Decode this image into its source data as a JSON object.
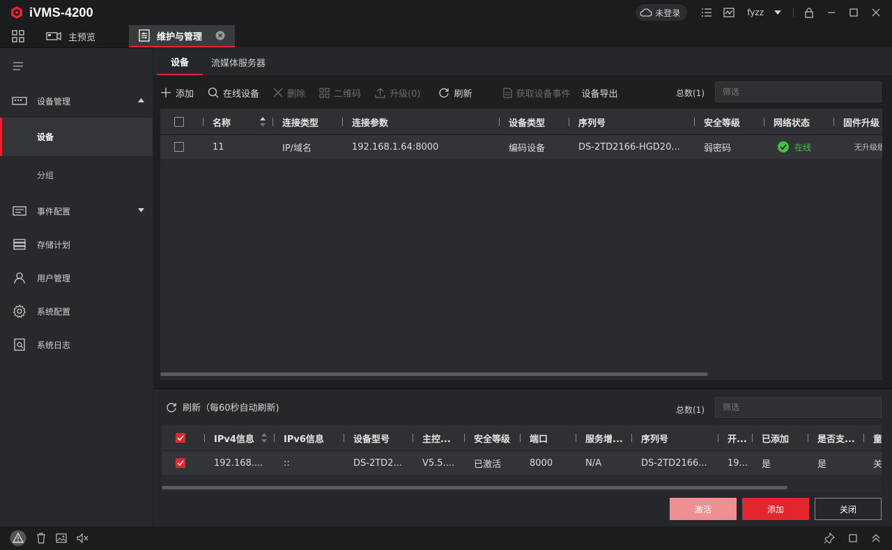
{
  "app": {
    "title": "iVMS-4200",
    "cloud_status": "未登录",
    "user": "fyzz"
  },
  "tabs": [
    {
      "label": "主预览"
    },
    {
      "label": "维护与管理"
    }
  ],
  "sidebar": {
    "items": [
      {
        "label": "设备管理",
        "icon": "device-manage-icon",
        "expanded": true
      },
      {
        "label": "设备",
        "sub": true,
        "active": true
      },
      {
        "label": "分组",
        "sub": true
      },
      {
        "label": "事件配置",
        "icon": "event-config-icon"
      },
      {
        "label": "存储计划",
        "icon": "storage-plan-icon"
      },
      {
        "label": "用户管理",
        "icon": "user-icon"
      },
      {
        "label": "系统配置",
        "icon": "gear-icon"
      },
      {
        "label": "系统日志",
        "icon": "log-icon"
      }
    ]
  },
  "subtabs": [
    "设备",
    "流媒体服务器"
  ],
  "toolbar": {
    "add": "添加",
    "online": "在线设备",
    "delete": "删除",
    "qrcode": "二维码",
    "upgrade": "升级(0)",
    "refresh": "刷新",
    "get_events": "获取设备事件",
    "export": "设备导出",
    "total": "总数(1)",
    "filter_placeholder": "筛选"
  },
  "device_table": {
    "headers": [
      "名称",
      "连接类型",
      "连接参数",
      "设备类型",
      "序列号",
      "安全等级",
      "网络状态",
      "固件升级"
    ],
    "rows": [
      {
        "name": "11",
        "conn_type": "IP/域名",
        "conn_param": "192.168.1.64:8000",
        "dev_type": "编码设备",
        "serial": "DS-2TD2166-HGD20...",
        "security": "弱密码",
        "status": "在线",
        "firmware": "无升级版"
      }
    ]
  },
  "lower": {
    "refresh": "刷新（每60秒自动刷新)",
    "total": "总数(1)",
    "filter_placeholder": "筛选",
    "headers": [
      "IPv4信息",
      "IPv6信息",
      "设备型号",
      "主控...",
      "安全等级",
      "端口",
      "服务增...",
      "序列号",
      "开...",
      "已添加",
      "是否支...",
      "童"
    ],
    "rows": [
      {
        "ipv4": "192.168....",
        "ipv6": "::",
        "model": "DS-2TD2...",
        "main": "V5.5....",
        "security": "已激活",
        "port": "8000",
        "service": "N/A",
        "serial": "DS-2TD2166...",
        "open": "19...",
        "added": "是",
        "support": "是",
        "extra": "关"
      }
    ],
    "buttons": {
      "activate": "激活",
      "add": "添加",
      "close": "关闭"
    }
  },
  "colors": {
    "accent": "#e6262e",
    "online": "#3ec43e"
  }
}
